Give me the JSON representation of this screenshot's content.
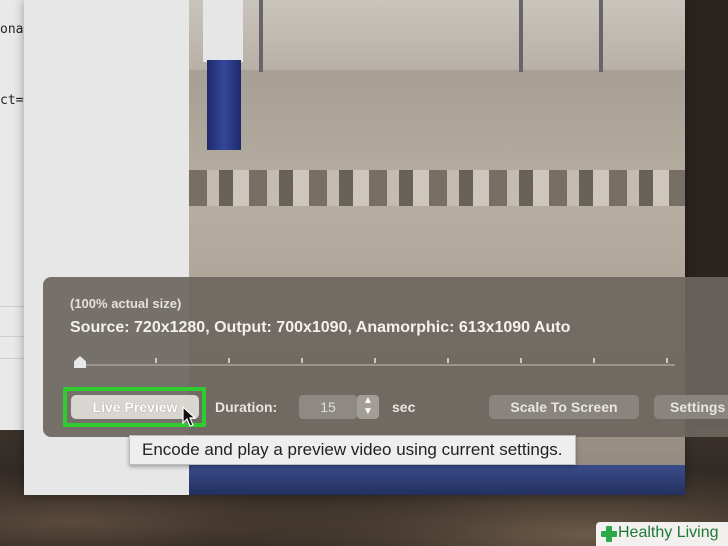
{
  "background_window": {
    "line1": "ona",
    "line2": "ct=("
  },
  "hud": {
    "size_label": "(100% actual size)",
    "source_info": "Source: 720x1280, Output: 700x1090, Anamorphic: 613x1090 Auto",
    "live_preview_label": "Live Preview",
    "duration_label": "Duration:",
    "duration_value": "15",
    "duration_unit": "sec",
    "scale_button_label": "Scale To Screen",
    "settings_button_label": "Settings",
    "slider_position": 0
  },
  "tooltip": {
    "text": "Encode and play a preview video using current settings."
  },
  "watermark": {
    "brand_text": "Healthy Living"
  },
  "colors": {
    "highlight": "#2ecc2e",
    "hud_bg": "#6c6660",
    "brand_green": "#1e7a34"
  }
}
